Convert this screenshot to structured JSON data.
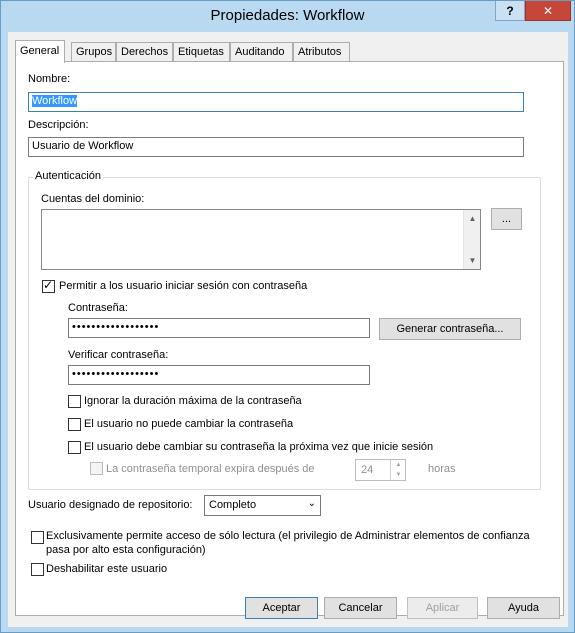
{
  "window": {
    "title": "Propiedades: Workflow",
    "help_glyph": "?",
    "close_glyph": "✕"
  },
  "tabs": [
    {
      "label": "General",
      "active": true
    },
    {
      "label": "Grupos"
    },
    {
      "label": "Derechos"
    },
    {
      "label": "Etiquetas"
    },
    {
      "label": "Auditando"
    },
    {
      "label": "Atributos"
    }
  ],
  "general": {
    "name_label": "Nombre:",
    "name_value": "Workflow",
    "description_label": "Descripción:",
    "description_value": "Usuario de Workflow"
  },
  "auth": {
    "group_title": "Autenticación",
    "domain_accounts_label": "Cuentas del dominio:",
    "browse_label": "...",
    "allow_password_label": "Permitir a los usuario iniciar sesión con contraseña",
    "allow_password_checked": true,
    "password_label": "Contraseña:",
    "password_value": "••••••••••••••••••",
    "generate_password_label": "Generar contraseña...",
    "verify_label": "Verificar contraseña:",
    "verify_value": "••••••••••••••••••",
    "ignore_max_duration_label": "Ignorar la duración máxima de la contraseña",
    "cannot_change_label": "El usuario no puede cambiar la contraseña",
    "must_change_label": "El usuario debe cambiar su contraseña la próxima vez que inicie sesión",
    "temp_expires_label": "La contraseña temporal expira después de",
    "temp_expires_value": "24",
    "temp_expires_unit": "horas"
  },
  "repository": {
    "label": "Usuario designado de repositorio:",
    "selected": "Completo"
  },
  "options": {
    "readonly_line1": "Exclusivamente permite acceso de sólo lectura (el privilegio de Administrar elementos de confianza",
    "readonly_line2": "pasa por alto esta configuración)",
    "disable_user_label": "Deshabilitar este usuario"
  },
  "footer": {
    "accept": "Aceptar",
    "cancel": "Cancelar",
    "apply": "Aplicar",
    "help": "Ayuda"
  }
}
